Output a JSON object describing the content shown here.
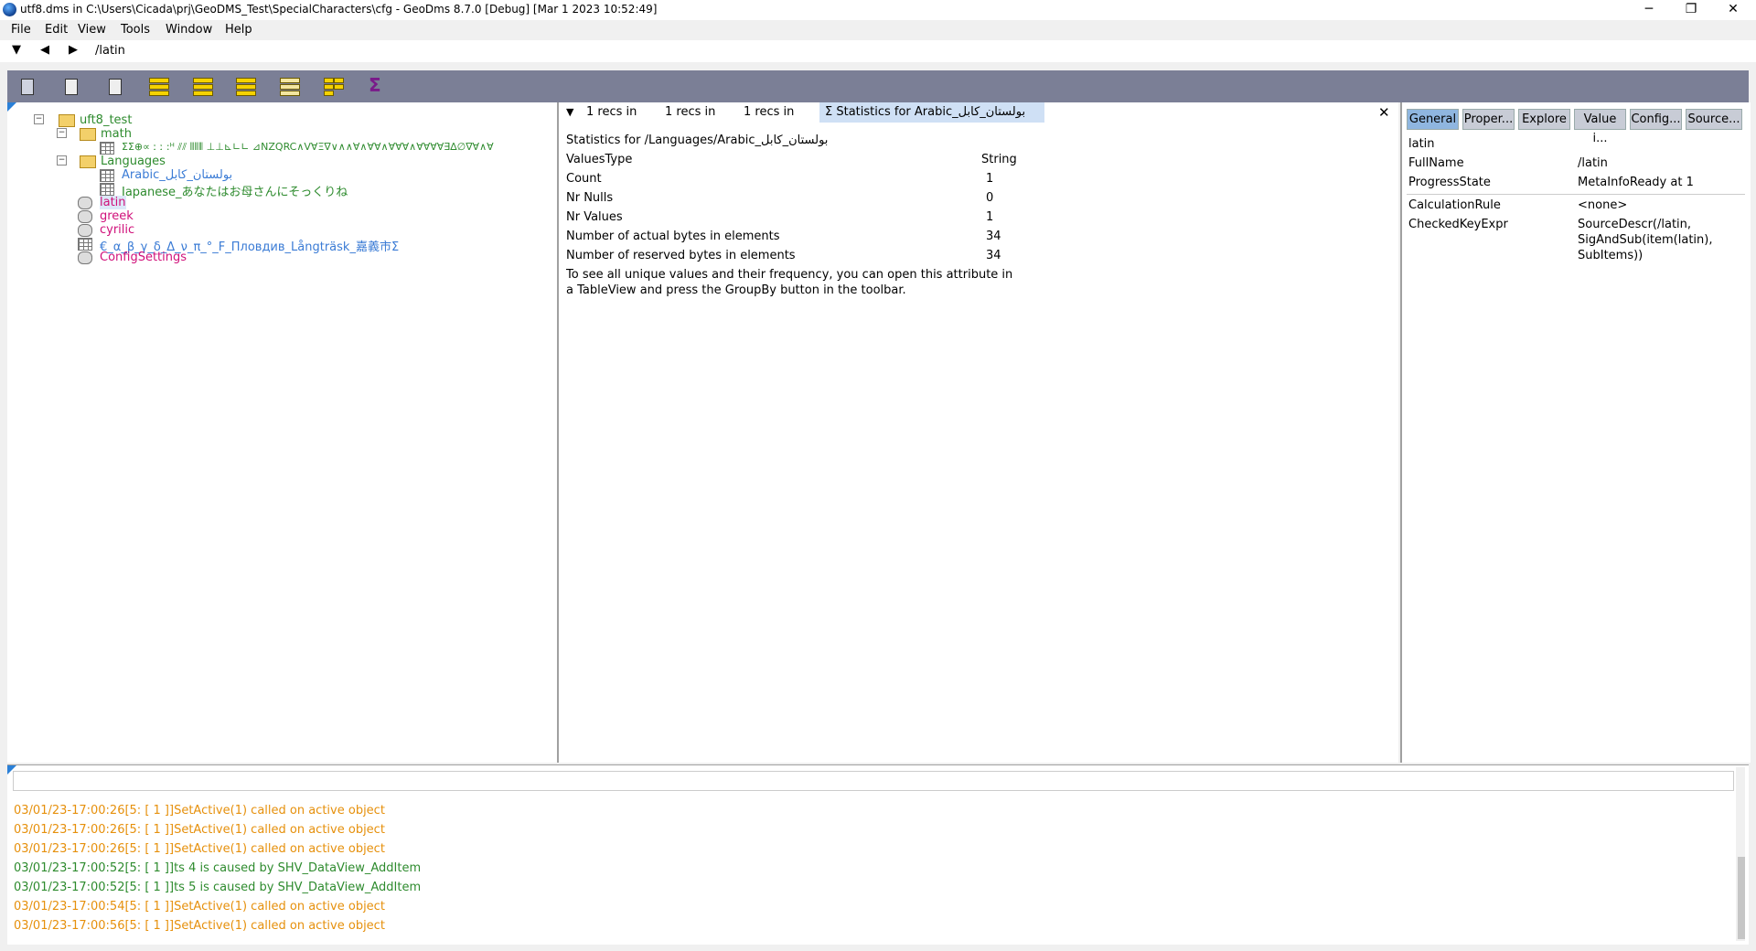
{
  "window": {
    "title": "utf8.dms in C:\\Users\\Cicada\\prj\\GeoDMS_Test\\SpecialCharacters\\cfg - GeoDms 8.7.0 [Debug] [Mar  1 2023 10:52:49]",
    "minimize": "─",
    "restore": "❐",
    "close": "✕"
  },
  "menu": [
    "File",
    "Edit",
    "View",
    "Tools",
    "Window",
    "Help"
  ],
  "address": {
    "down": "▼",
    "back": "◀",
    "forward": "▶",
    "path": "/latin"
  },
  "toolbar": {
    "icons": [
      "save-icon",
      "copy-icon",
      "paste-icon",
      "table-view-icon",
      "table-view-cursor-icon",
      "map-view-icon",
      "list-view-icon",
      "split-view-icon",
      "statistics-sigma-icon"
    ],
    "sigma": "Σ"
  },
  "tree": {
    "root": "uft8_test",
    "math": "math",
    "math_child": "ΣΣ⊕∝ ː ː :ᴴ ⫽⫽ ⦀⦀⦀ ⊥⊥⊾∟∟ ⊿NZQRC∧V∀Ξ∇∨∧∧∀∧∀∀∧∀∀∀∧∀∀∀∀∃∆∅∇∀∧∀",
    "languages": "Languages",
    "arabic": "Arabic_بولستان_كابل",
    "japanese": "Japanese_あなたはお母さんにそっくりね",
    "latin": "latin",
    "greek": "greek",
    "cyrilic": "cyrilic",
    "special": "€_α_β_γ_δ_Δ_ν_π_°_F_Пловдив_Långträsk_嘉義市Σ",
    "config": "ConfigSettings"
  },
  "middle": {
    "filter_icon": "▼",
    "tabs": [
      "1 recs in",
      "1 recs in",
      "1 recs in",
      "Σ Statistics for Arabic_بولستان_كابل"
    ],
    "close": "✕",
    "heading": "Statistics for /Languages/Arabic_بولستان_كابل",
    "stats": [
      {
        "label": "ValuesType",
        "value": "String"
      },
      {
        "label": "Count",
        "value": "1"
      },
      {
        "label": "Nr Nulls",
        "value": "0"
      },
      {
        "label": "Nr Values",
        "value": "1"
      },
      {
        "label": "Number of actual   bytes in elements",
        "value": "34"
      },
      {
        "label": "Number of reserved bytes in elements",
        "value": "34"
      }
    ],
    "note_line1": "To see all unique values and their frequency, you can open this attribute in",
    "note_line2": "a TableView and press the GroupBy button in the toolbar."
  },
  "right": {
    "tabs": [
      "General",
      "Proper...",
      "Explore",
      "Value i...",
      "Config...",
      "Source..."
    ],
    "item": "latin",
    "props": [
      {
        "key": "FullName",
        "value": "/latin"
      },
      {
        "key": "ProgressState",
        "value": "MetaInfoReady at 1"
      },
      {
        "key": "CalculationRule",
        "value": "<none>"
      },
      {
        "key": "CheckedKeyExpr",
        "value": "SourceDescr(/latin,"
      }
    ],
    "checked_line2": "SigAndSub(item(latin),",
    "checked_line3": "SubItems))"
  },
  "log": {
    "lines": [
      {
        "text": "03/01/23-17:00:26[5: [     1 ]]SetActive(1) called on active object",
        "color": "orange"
      },
      {
        "text": "03/01/23-17:00:26[5: [     1 ]]SetActive(1) called on active object",
        "color": "orange"
      },
      {
        "text": "03/01/23-17:00:26[5: [     1 ]]SetActive(1) called on active object",
        "color": "orange"
      },
      {
        "text": "03/01/23-17:00:52[5: [     1 ]]ts 4 is caused by SHV_DataView_AddItem",
        "color": "green"
      },
      {
        "text": "03/01/23-17:00:52[5: [     1 ]]ts 5 is caused by SHV_DataView_AddItem",
        "color": "green"
      },
      {
        "text": "03/01/23-17:00:54[5: [     1 ]]SetActive(1) called on active object",
        "color": "orange"
      },
      {
        "text": "03/01/23-17:00:56[5: [     1 ]]SetActive(1) called on active object",
        "color": "orange"
      }
    ]
  }
}
